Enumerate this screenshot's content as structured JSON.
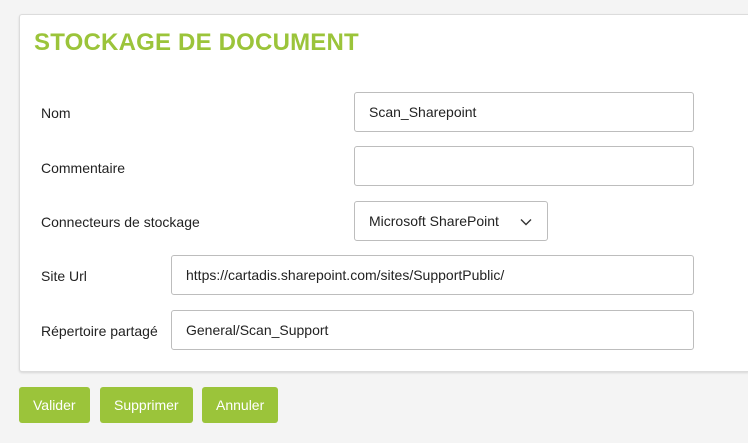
{
  "section": {
    "title": "STOCKAGE DE DOCUMENT"
  },
  "form": {
    "nom": {
      "label": "Nom",
      "value": "Scan_Sharepoint"
    },
    "commentaire": {
      "label": "Commentaire",
      "value": ""
    },
    "connecteur": {
      "label": "Connecteurs de stockage",
      "selected": "Microsoft SharePoint"
    },
    "site_url": {
      "label": "Site Url",
      "value": "https://cartadis.sharepoint.com/sites/SupportPublic/"
    },
    "repertoire": {
      "label": "Répertoire partagé",
      "value": "General/Scan_Support"
    }
  },
  "actions": {
    "valider": "Valider",
    "supprimer": "Supprimer",
    "annuler": "Annuler"
  },
  "colors": {
    "accent": "#9bc43a",
    "background": "#f4f4f4",
    "card": "#ffffff"
  },
  "icons": {
    "dropdown": "chevron-down-icon"
  }
}
